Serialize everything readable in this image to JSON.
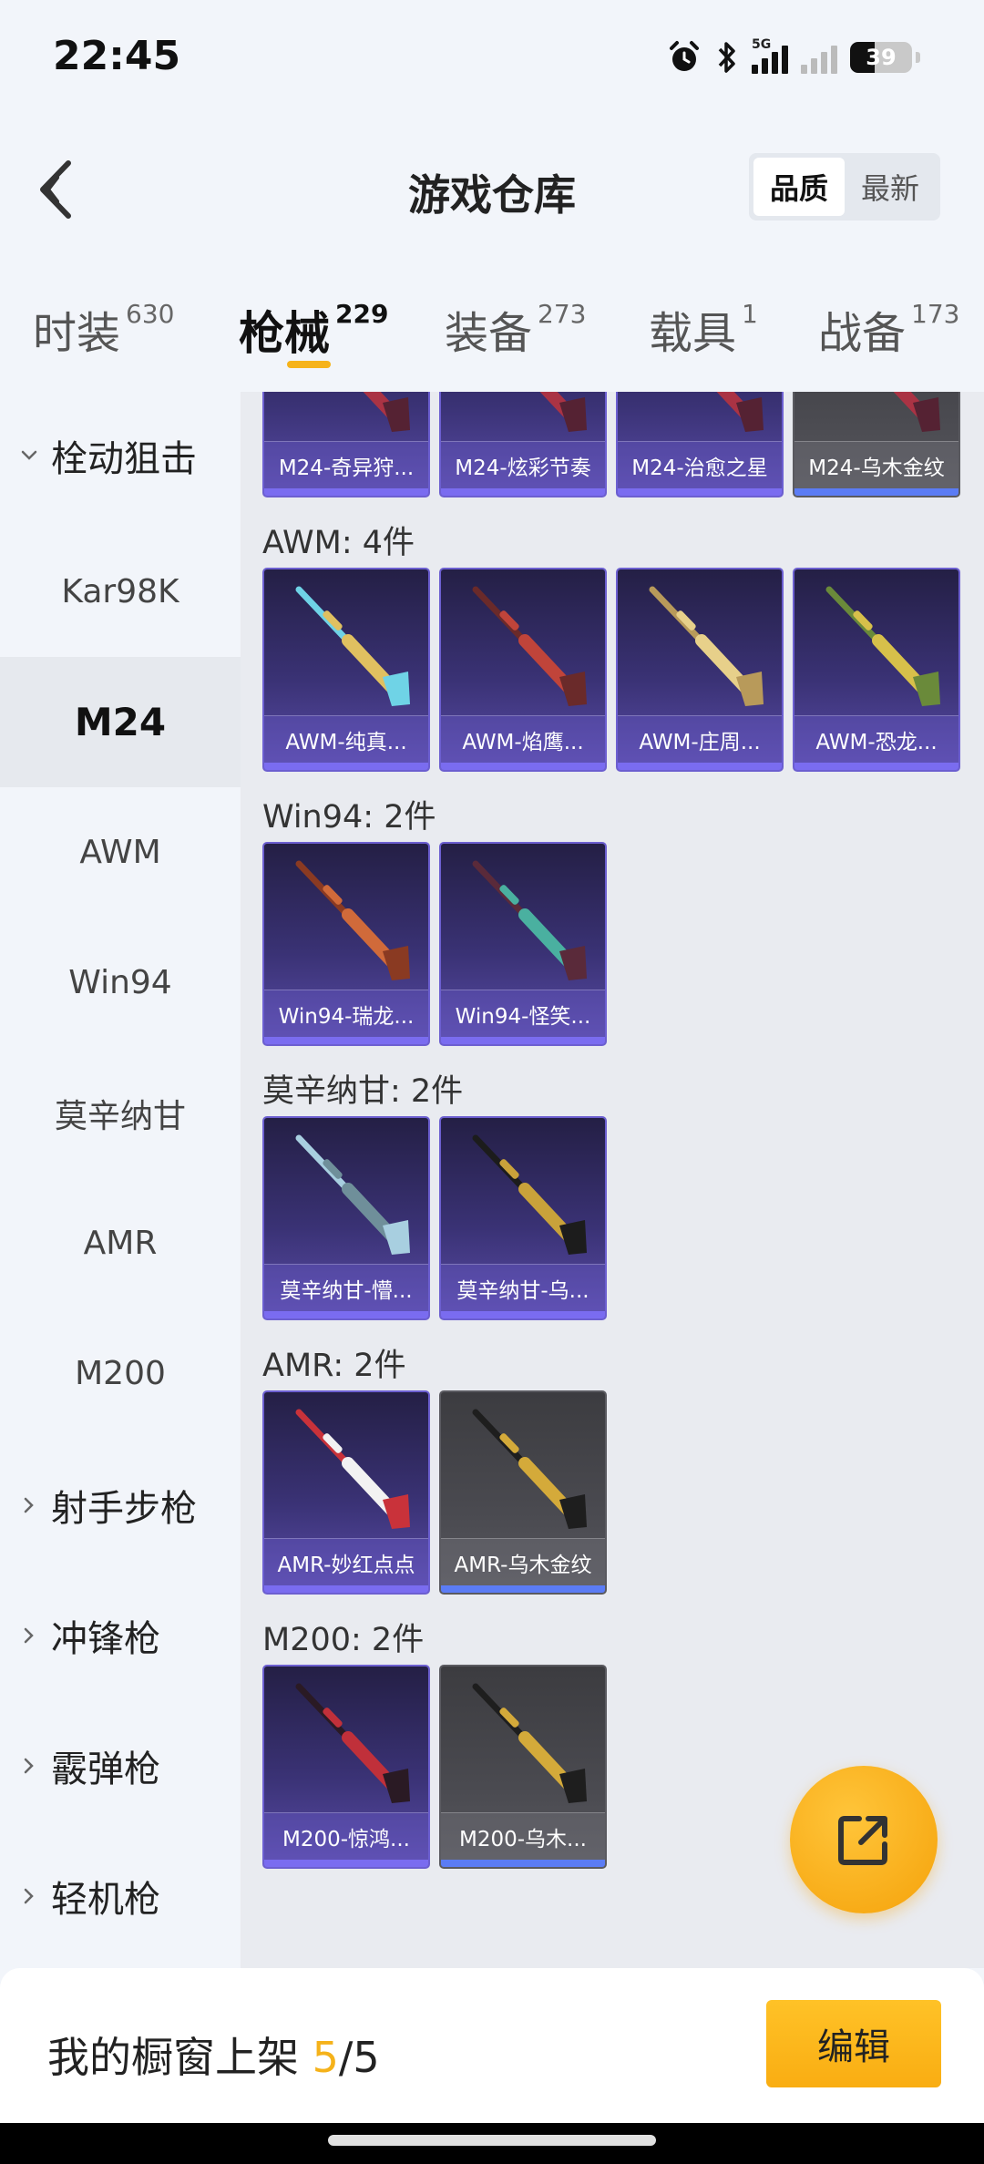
{
  "status_bar": {
    "time": "22:45",
    "network": "5G",
    "battery": "39",
    "battery_level": 0.39
  },
  "header": {
    "title": "游戏仓库",
    "sort_options": [
      "品质",
      "最新"
    ],
    "sort_active": "品质"
  },
  "tabs": [
    {
      "label": "时装",
      "count": "630"
    },
    {
      "label": "枪械",
      "count": "229",
      "active": true
    },
    {
      "label": "装备",
      "count": "273"
    },
    {
      "label": "载具",
      "count": "1"
    },
    {
      "label": "战备",
      "count": "173"
    }
  ],
  "sidebar": {
    "group_open": "栓动狙击",
    "items": [
      "Kar98K",
      "M24",
      "AWM",
      "Win94",
      "莫辛纳甘",
      "AMR",
      "M200"
    ],
    "active_item": "M24",
    "collapsed_groups": [
      "射手步枪",
      "冲锋枪",
      "霰弹枪",
      "轻机枪"
    ]
  },
  "sections": [
    {
      "title": "",
      "cards": [
        {
          "label": "M24-奇异狩...",
          "quality": "purple"
        },
        {
          "label": "M24-炫彩节奏",
          "quality": "purple"
        },
        {
          "label": "M24-治愈之星",
          "quality": "purple"
        },
        {
          "label": "M24-乌木金纹",
          "quality": "gray"
        }
      ]
    },
    {
      "title": "AWM: 4件",
      "cards": [
        {
          "label": "AWM-纯真...",
          "quality": "purple",
          "gun": "cyan"
        },
        {
          "label": "AWM-焰鹰...",
          "quality": "purple",
          "gun": "red"
        },
        {
          "label": "AWM-庄周...",
          "quality": "purple",
          "gun": "gold"
        },
        {
          "label": "AWM-恐龙...",
          "quality": "purple",
          "gun": "green"
        }
      ]
    },
    {
      "title": "Win94: 2件",
      "cards": [
        {
          "label": "Win94-瑞龙...",
          "quality": "purple",
          "gun": "brown"
        },
        {
          "label": "Win94-怪笑...",
          "quality": "purple",
          "gun": "teal"
        }
      ]
    },
    {
      "title": "莫辛纳甘: 2件",
      "cards": [
        {
          "label": "莫辛纳甘-懵...",
          "quality": "purple",
          "gun": "ice"
        },
        {
          "label": "莫辛纳甘-乌...",
          "quality": "purple",
          "gun": "black"
        }
      ]
    },
    {
      "title": "AMR: 2件",
      "cards": [
        {
          "label": "AMR-妙红点点",
          "quality": "purple",
          "gun": "red-white"
        },
        {
          "label": "AMR-乌木金纹",
          "quality": "gray",
          "gun": "black-gold"
        }
      ]
    },
    {
      "title": "M200: 2件",
      "cards": [
        {
          "label": "M200-惊鸿...",
          "quality": "purple",
          "gun": "dark-red"
        },
        {
          "label": "M200-乌木...",
          "quality": "gray",
          "gun": "black-gold"
        }
      ]
    }
  ],
  "bottom": {
    "shelf_label": "我的橱窗上架",
    "shelf_used": "5",
    "shelf_total": "/5",
    "edit_label": "编辑"
  },
  "colors": {
    "accent": "#f6b31a",
    "card_purple": "#3a3275",
    "card_gray": "#4a4a50"
  },
  "icons": [
    "back-arrow-icon",
    "chevron-down-icon",
    "chevron-right-icon",
    "share-external-icon",
    "alarm-icon",
    "bluetooth-icon"
  ]
}
